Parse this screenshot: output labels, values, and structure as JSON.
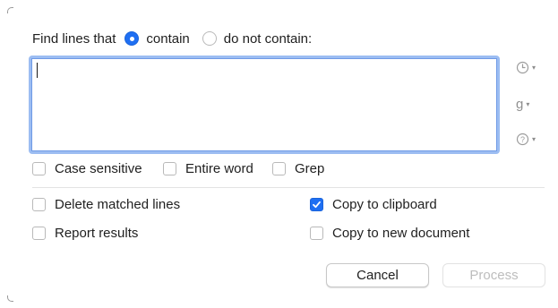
{
  "find": {
    "label": "Find lines that",
    "options": [
      {
        "label": "contain",
        "selected": true
      },
      {
        "label": "do not contain:",
        "selected": false
      }
    ]
  },
  "pattern": {
    "value": ""
  },
  "side_buttons": [
    {
      "icon": "clock-icon"
    },
    {
      "icon": "grep-pattern-g-icon",
      "glyph": "g"
    },
    {
      "icon": "help-icon"
    }
  ],
  "match_options": [
    {
      "label": "Case sensitive",
      "checked": false
    },
    {
      "label": "Entire word",
      "checked": false
    },
    {
      "label": "Grep",
      "checked": false
    }
  ],
  "action_options": {
    "delete_matched": {
      "label": "Delete matched lines",
      "checked": false
    },
    "report_results": {
      "label": "Report results",
      "checked": false
    },
    "copy_clipboard": {
      "label": "Copy to clipboard",
      "checked": true
    },
    "copy_new_doc": {
      "label": "Copy to new document",
      "checked": false
    }
  },
  "buttons": {
    "cancel": "Cancel",
    "process": "Process",
    "process_enabled": false
  },
  "colors": {
    "accent": "#1f6ff2",
    "focus_ring": "#9cbdf2",
    "disabled_text": "#bdbdbd"
  }
}
